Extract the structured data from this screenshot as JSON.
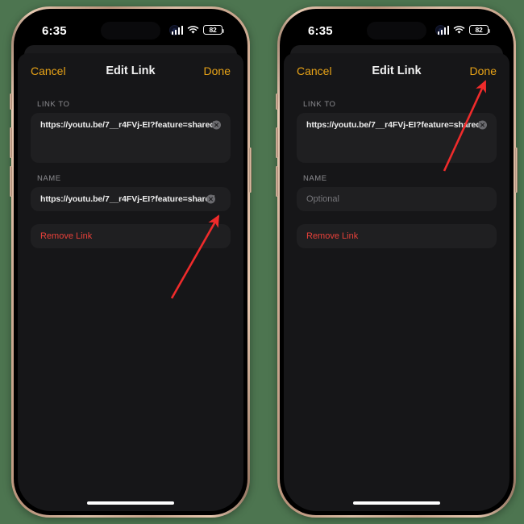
{
  "background_color": "#4d7550",
  "accent_color": "#e8a317",
  "destructive_color": "#e8413a",
  "annotation_color": "#ef2b2b",
  "status_bar": {
    "time": "6:35",
    "battery_level": "82",
    "cellular_icon": "cellular-bars-icon",
    "wifi_icon": "wifi-icon",
    "battery_icon": "battery-icon",
    "face_id_icon": "face-id-indicator-icon",
    "dynamic_island": "dynamic-island"
  },
  "navbar": {
    "cancel_label": "Cancel",
    "title": "Edit Link",
    "done_label": "Done"
  },
  "sections": {
    "link_to_label": "LINK TO",
    "name_label": "NAME"
  },
  "clear_icon": "clear-circle-x-icon",
  "remove": {
    "label": "Remove Link"
  },
  "phones": [
    {
      "id": "left",
      "link_to_value": "https://youtu.be/7__r4FVj-EI?feature=shared",
      "name_value": "https://youtu.be/7__r4FVj-EI?feature=shared",
      "name_is_placeholder": false,
      "name_clear_visible": true,
      "annotation_target": "name-field-clear-button"
    },
    {
      "id": "right",
      "link_to_value": "https://youtu.be/7__r4FVj-EI?feature=shared",
      "name_value": "Optional",
      "name_is_placeholder": true,
      "name_clear_visible": false,
      "annotation_target": "done-button"
    }
  ]
}
